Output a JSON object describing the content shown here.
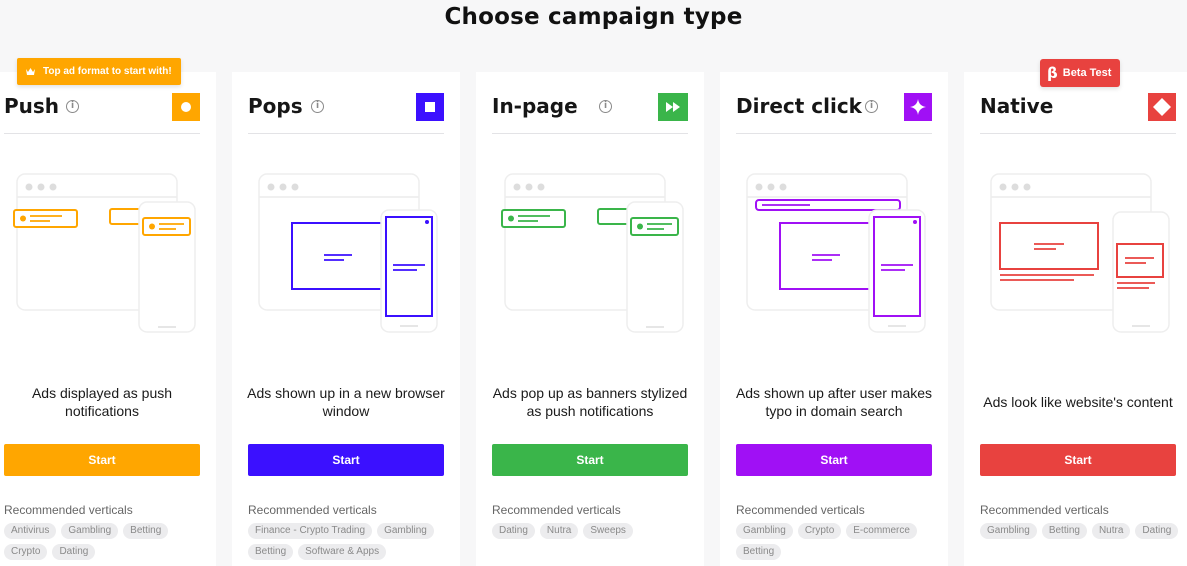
{
  "page": {
    "title": "Choose campaign type"
  },
  "badges": {
    "top_format": "Top ad format to start with!",
    "beta_symbol": "β",
    "beta": "Beta Test"
  },
  "recommended_label": "Recommended verticals",
  "colors": {
    "push": "#ffa600",
    "pops": "#3b10ff",
    "inpage": "#3ab54a",
    "directclick": "#a010f5",
    "native": "#e8423f"
  },
  "cards": [
    {
      "title": "Push",
      "info_icon": "i",
      "icon": "circle-icon",
      "description": "Ads displayed as push notifications",
      "button": "Start",
      "tags": [
        "Antivirus",
        "Gambling",
        "Betting",
        "Crypto",
        "Dating"
      ]
    },
    {
      "title": "Pops",
      "info_icon": "i",
      "icon": "square-icon",
      "description": "Ads shown up in a new browser window",
      "button": "Start",
      "tags": [
        "Finance - Crypto Trading",
        "Gambling",
        "Betting",
        "Software & Apps"
      ]
    },
    {
      "title": "In-page",
      "info_icon": "i",
      "icon": "fast-forward-icon",
      "description": "Ads pop up as banners stylized as push notifications",
      "button": "Start",
      "tags": [
        "Dating",
        "Nutra",
        "Sweeps"
      ]
    },
    {
      "title": "Direct click",
      "info_icon": "i",
      "icon": "sparkle-icon",
      "description": "Ads shown up after user makes typo in domain search",
      "button": "Start",
      "tags": [
        "Gambling",
        "Crypto",
        "E-commerce",
        "Betting"
      ]
    },
    {
      "title": "Native",
      "info_icon": "",
      "icon": "diamond-icon",
      "description": "Ads look like website's content",
      "button": "Start",
      "tags": [
        "Gambling",
        "Betting",
        "Nutra",
        "Dating"
      ]
    }
  ]
}
